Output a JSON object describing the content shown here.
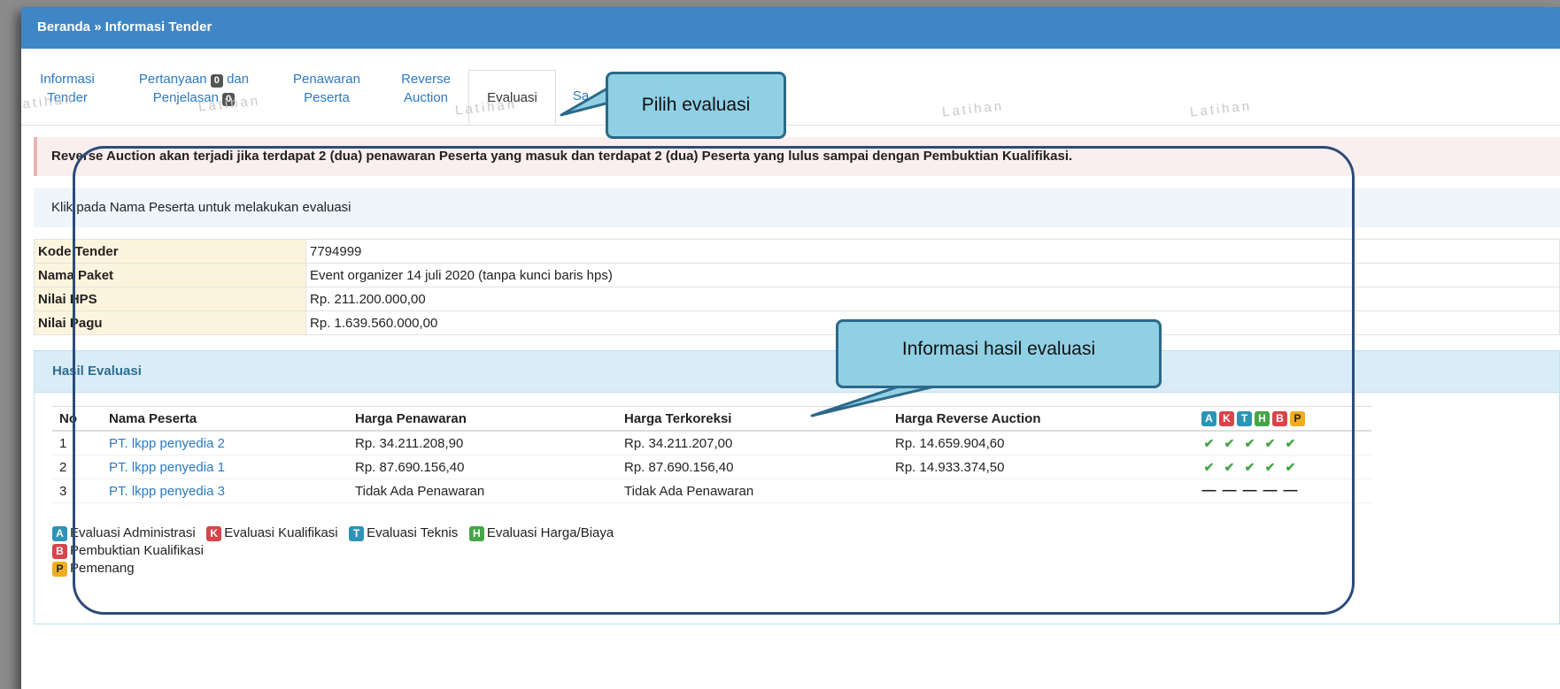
{
  "breadcrumb": "Beranda » Informasi Tender",
  "tabs": {
    "informasi_tender": [
      "Informasi",
      "Tender"
    ],
    "pertanyaan": [
      "Pertanyaan",
      "dan",
      "Penjelasan"
    ],
    "pertanyaan_count": "0",
    "penjelasan_count": "0",
    "penawaran": [
      "Penawaran",
      "Peserta"
    ],
    "reverse": [
      "Reverse",
      "Auction"
    ],
    "evaluasi": "Evaluasi",
    "sanggah_partial": "Sa"
  },
  "watermark": "Latihan",
  "callouts": {
    "pilih": "Pilih evaluasi",
    "info": "Informasi hasil evaluasi"
  },
  "alert": "Reverse Auction akan terjadi jika terdapat 2 (dua) penawaran Peserta yang masuk dan terdapat 2 (dua) Peserta yang lulus sampai dengan Pembuktian Kualifikasi.",
  "info_text": "Klik pada Nama Peserta untuk melakukan evaluasi",
  "details": [
    {
      "label": "Kode Tender",
      "value": "7794999"
    },
    {
      "label": "Nama Paket",
      "value": "Event organizer 14 juli 2020 (tanpa kunci baris hps)"
    },
    {
      "label": "Nilai HPS",
      "value": "Rp. 211.200.000,00"
    },
    {
      "label": "Nilai Pagu",
      "value": "Rp. 1.639.560.000,00"
    }
  ],
  "hasil": {
    "title": "Hasil Evaluasi",
    "headers": [
      "No",
      "Nama Peserta",
      "Harga Penawaran",
      "Harga Terkoreksi",
      "Harga Reverse Auction"
    ],
    "status_cols": [
      "A",
      "K",
      "T",
      "H",
      "B",
      "P"
    ],
    "rows": [
      {
        "no": "1",
        "nama": "PT. lkpp penyedia 2",
        "penawaran": "Rp. 34.211.208,90",
        "terkoreksi": "Rp. 34.211.207,00",
        "reverse": "Rp. 14.659.904,60",
        "status": "check"
      },
      {
        "no": "2",
        "nama": "PT. lkpp penyedia 1",
        "penawaran": "Rp. 87.690.156,40",
        "terkoreksi": "Rp. 87.690.156,40",
        "reverse": "Rp. 14.933.374,50",
        "status": "check"
      },
      {
        "no": "3",
        "nama": "PT. lkpp penyedia 3",
        "penawaran": "Tidak Ada Penawaran",
        "terkoreksi": "Tidak Ada Penawaran",
        "reverse": "",
        "status": "dash"
      }
    ]
  },
  "legend": {
    "A": "Evaluasi Administrasi",
    "K": "Evaluasi Kualifikasi",
    "T": "Evaluasi Teknis",
    "H": "Evaluasi Harga/Biaya",
    "B": "Pembuktian Kualifikasi",
    "P": "Pemenang"
  },
  "colors": {
    "header_blue": "#3f86c5",
    "check_green": "#45a547",
    "badge_red": "#d9434b",
    "badge_blue": "#2c94b6",
    "badge_yellow": "#f0ad1e"
  }
}
